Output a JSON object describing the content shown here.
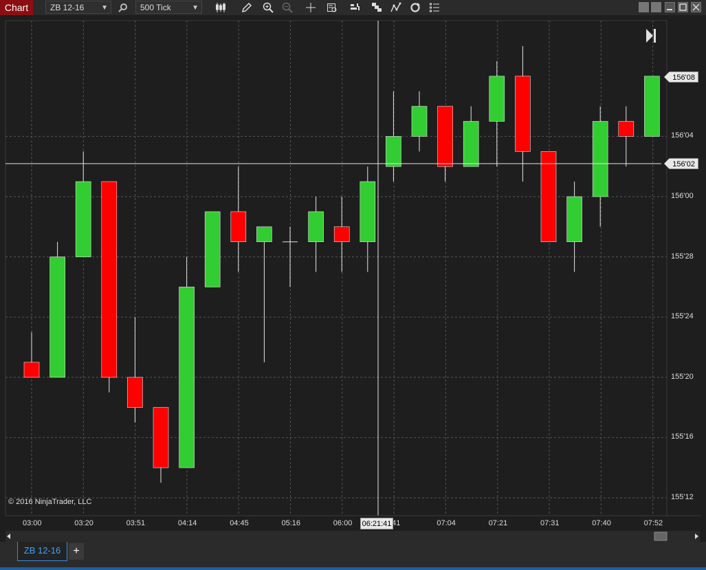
{
  "window": {
    "title": "Chart"
  },
  "toolbar": {
    "instrument": "ZB 12-16",
    "interval": "500 Tick",
    "icons": [
      "search-icon",
      "bars-type-icon",
      "pencil-draw-icon",
      "zoom-in-icon",
      "zoom-out-icon",
      "crosshair-icon",
      "data-box-icon",
      "indicators-icon",
      "strategies-icon",
      "drawing-tools-icon",
      "refresh-icon",
      "properties-icon"
    ]
  },
  "chart": {
    "copyright": "© 2016 NinjaTrader, LLC",
    "crosshair_price": "156'02",
    "crosshair_time": "06:21:41",
    "last_price": "156'08",
    "colors": {
      "up": "#32cd32",
      "down": "#ff0000",
      "background": "#1e1e1e",
      "grid": "#555555"
    }
  },
  "chart_data": {
    "type": "candlestick",
    "price_format": "32nds",
    "y_ticks": [
      "156'04",
      "156'00",
      "155'28",
      "155'24",
      "155'20",
      "155'16",
      "155'12"
    ],
    "x_ticks": [
      "03:00",
      "03:20",
      "03:51",
      "04:14",
      "04:45",
      "05:16",
      "06:00",
      "41",
      "07:04",
      "07:21",
      "07:31",
      "07:40",
      "07:52"
    ],
    "ylim": [
      "155'12",
      "156'09"
    ],
    "candles": [
      {
        "open": "155'21",
        "high": "155'23",
        "low": "155'20",
        "close": "155'20"
      },
      {
        "open": "155'20",
        "high": "155'29",
        "low": "155'20",
        "close": "155'28"
      },
      {
        "open": "155'28",
        "high": "156'03",
        "low": "155'28",
        "close": "156'01"
      },
      {
        "open": "156'01",
        "high": "156'01",
        "low": "155'19",
        "close": "155'20"
      },
      {
        "open": "155'20",
        "high": "155'24",
        "low": "155'17",
        "close": "155'18"
      },
      {
        "open": "155'18",
        "high": "155'18",
        "low": "155'13",
        "close": "155'14"
      },
      {
        "open": "155'14",
        "high": "155'28",
        "low": "155'14",
        "close": "155'26"
      },
      {
        "open": "155'26",
        "high": "155'31",
        "low": "155'26",
        "close": "155'31"
      },
      {
        "open": "155'31",
        "high": "156'02",
        "low": "155'27",
        "close": "155'29"
      },
      {
        "open": "155'29",
        "high": "155'30",
        "low": "155'21",
        "close": "155'30"
      },
      {
        "open": "155'29",
        "high": "155'30",
        "low": "155'26",
        "close": "155'29"
      },
      {
        "open": "155'29",
        "high": "156'00",
        "low": "155'27",
        "close": "155'31"
      },
      {
        "open": "155'30",
        "high": "156'00",
        "low": "155'27",
        "close": "155'29"
      },
      {
        "open": "155'29",
        "high": "156'02",
        "low": "155'27",
        "close": "156'01"
      },
      {
        "open": "156'02",
        "high": "156'07",
        "low": "156'01",
        "close": "156'04"
      },
      {
        "open": "156'04",
        "high": "156'07",
        "low": "156'03",
        "close": "156'06"
      },
      {
        "open": "156'06",
        "high": "156'06",
        "low": "156'01",
        "close": "156'02"
      },
      {
        "open": "156'02",
        "high": "156'06",
        "low": "156'02",
        "close": "156'05"
      },
      {
        "open": "156'05",
        "high": "156'09",
        "low": "156'02",
        "close": "156'08"
      },
      {
        "open": "156'08",
        "high": "156'10",
        "low": "156'01",
        "close": "156'03"
      },
      {
        "open": "156'03",
        "high": "156'03",
        "low": "155'29",
        "close": "155'29"
      },
      {
        "open": "155'29",
        "high": "156'01",
        "low": "155'27",
        "close": "156'00"
      },
      {
        "open": "156'00",
        "high": "156'06",
        "low": "155'30",
        "close": "156'05"
      },
      {
        "open": "156'05",
        "high": "156'06",
        "low": "156'02",
        "close": "156'04"
      },
      {
        "open": "156'04",
        "high": "156'08",
        "low": "156'04",
        "close": "156'08"
      }
    ]
  },
  "tabs": {
    "instrument_tab": "ZB 12-16",
    "add_tab": "+"
  }
}
